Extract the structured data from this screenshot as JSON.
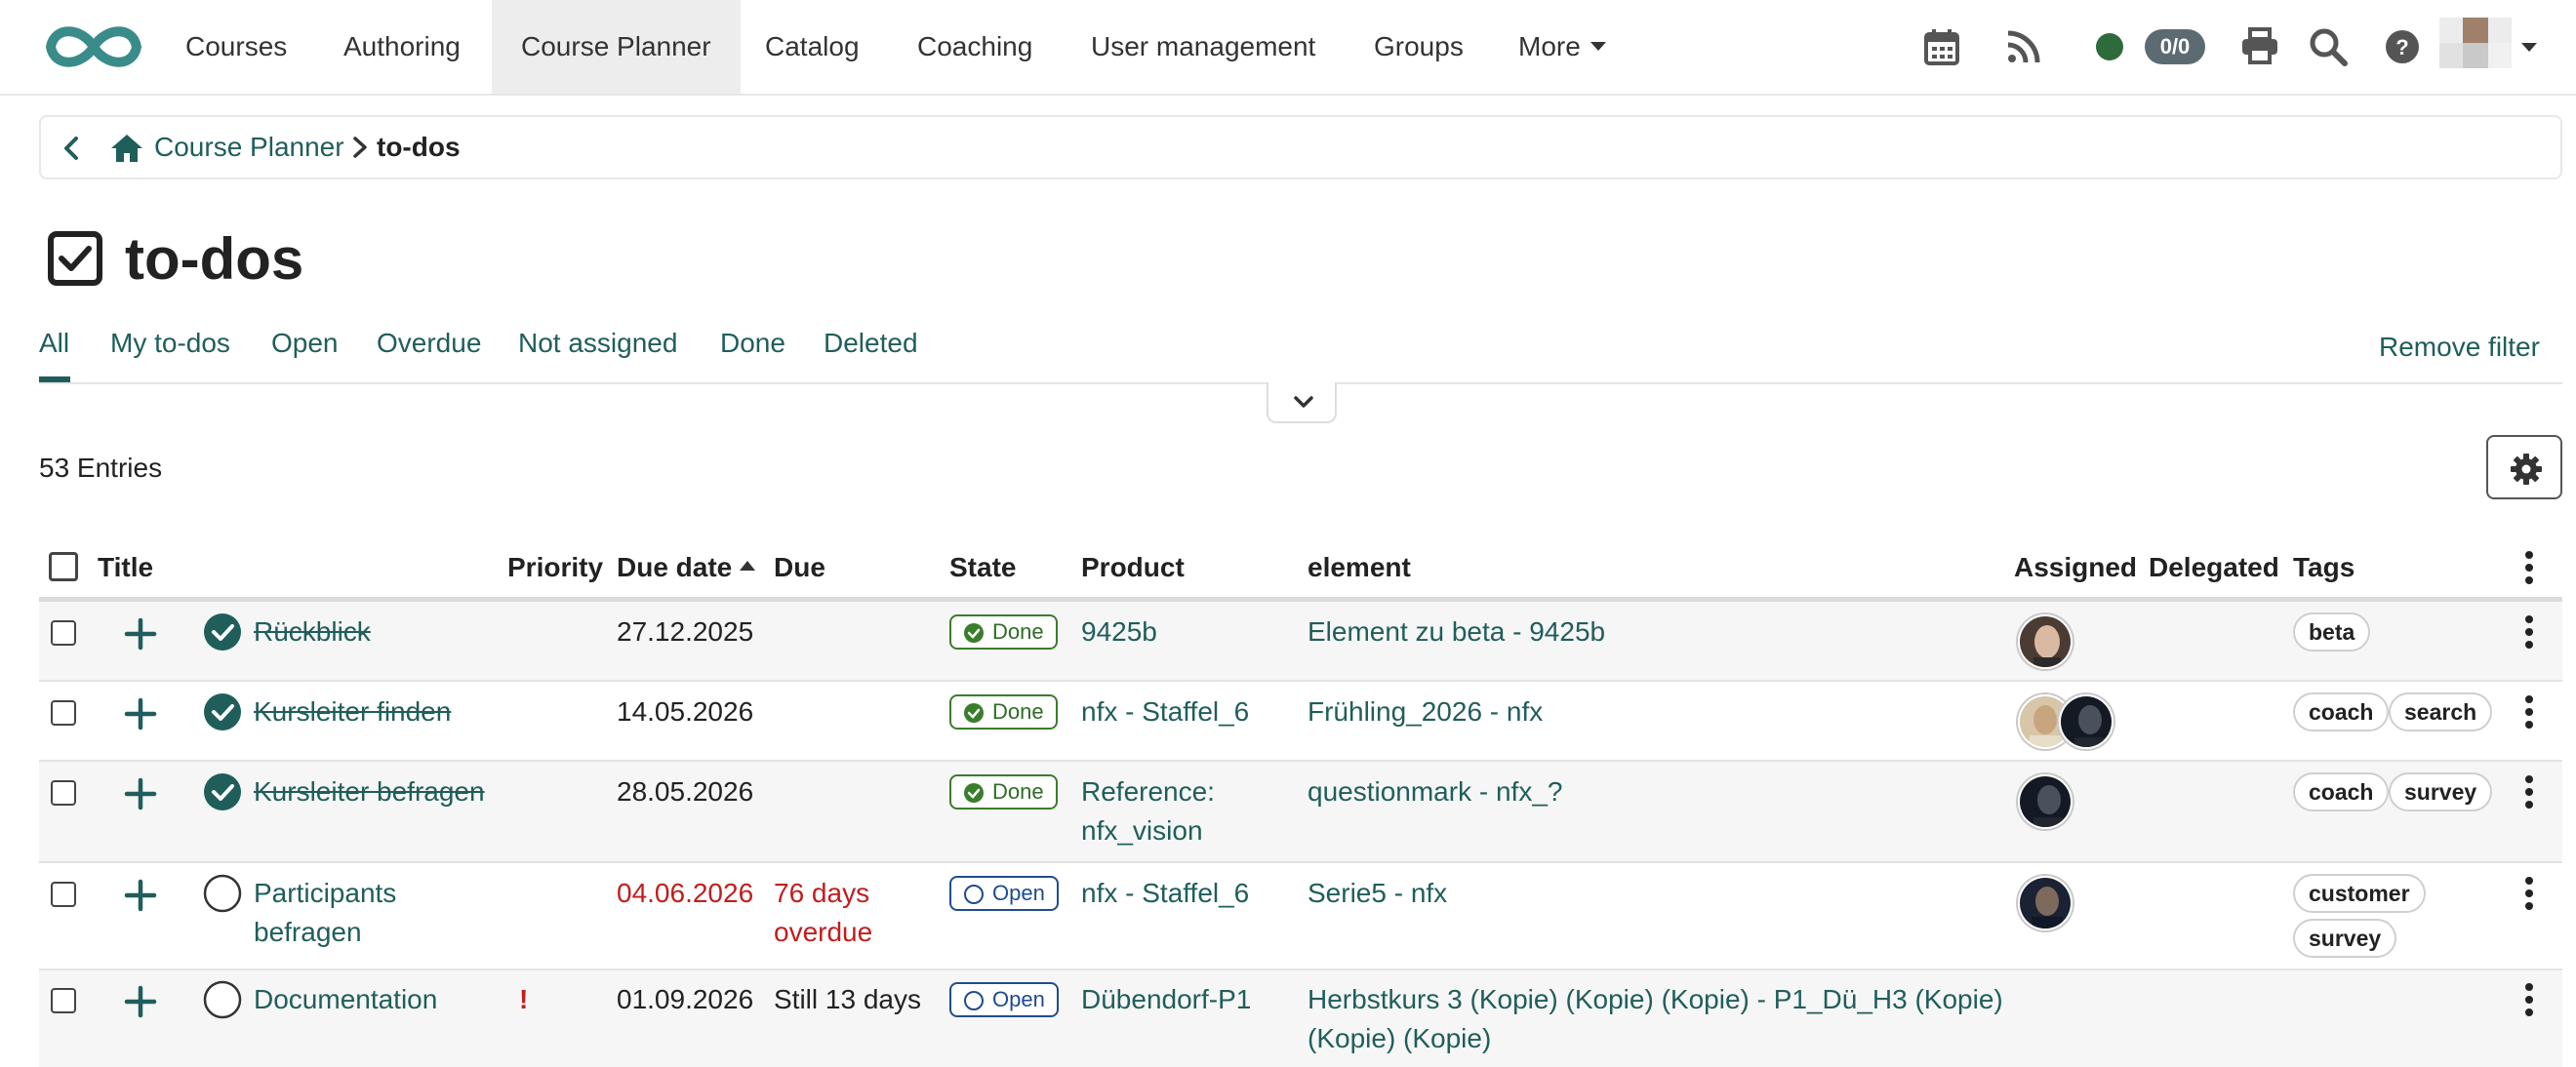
{
  "nav": {
    "items": [
      "Courses",
      "Authoring",
      "Course Planner",
      "Catalog",
      "Coaching",
      "User management",
      "Groups",
      "More"
    ],
    "active": "Course Planner",
    "badge_count": "0/0",
    "status_color": "#2e6b3a",
    "icons": [
      "calendar-icon",
      "rss-icon",
      "print-icon",
      "search-icon",
      "help-icon"
    ]
  },
  "breadcrumb": {
    "parent": "Course Planner",
    "current": "to-dos"
  },
  "page": {
    "title": "to-dos"
  },
  "tabs": [
    "All",
    "My to-dos",
    "Open",
    "Overdue",
    "Not assigned",
    "Done",
    "Deleted"
  ],
  "active_tab": "All",
  "remove_filter": "Remove filter",
  "entries": "53 Entries",
  "table": {
    "headers": {
      "title": "Title",
      "priority": "Priority",
      "due_date": "Due date",
      "due": "Due",
      "state": "State",
      "product": "Product",
      "element": "element",
      "assigned": "Assigned",
      "delegated": "Delegated",
      "tags": "Tags"
    },
    "rows": [
      {
        "title": "Rückblick",
        "priority": "",
        "due_date": "27.12.2025",
        "due": "",
        "state": "Done",
        "product": "9425b",
        "element": "Element zu beta - 9425b",
        "tags": [
          "beta"
        ]
      },
      {
        "title": "Kursleiter finden",
        "priority": "",
        "due_date": "14.05.2026",
        "due": "",
        "state": "Done",
        "product": "nfx - Staffel_6",
        "element": "Frühling_2026 - nfx",
        "tags": [
          "coach",
          "search"
        ]
      },
      {
        "title": "Kursleiter befragen",
        "priority": "",
        "due_date": "28.05.2026",
        "due": "",
        "state": "Done",
        "product_line1": "Reference:",
        "product_line2": "nfx_vision",
        "element": "questionmark - nfx_?",
        "tags": [
          "coach",
          "survey"
        ]
      },
      {
        "title_line1": "Participants",
        "title_line2": "befragen",
        "priority": "",
        "due_date": "04.06.2026",
        "due_line1": "76 days",
        "due_line2": "overdue",
        "state": "Open",
        "product": "nfx - Staffel_6",
        "element": "Serie5 - nfx",
        "tags": [
          "customer",
          "survey"
        ]
      },
      {
        "title": "Documentation",
        "priority": "!",
        "due_date": "01.09.2026",
        "due": "Still 13 days",
        "state": "Open",
        "product": "Dübendorf-P1",
        "element_line1": "Herbstkurs 3 (Kopie) (Kopie) (Kopie) - P1_Dü_H3 (Kopie)",
        "element_line2": "(Kopie) (Kopie)",
        "tags": []
      }
    ]
  },
  "colors": {
    "accent": "#1f5e5b",
    "overdue": "#c21d1d",
    "done": "#3a7d2b",
    "open": "#1f4c8f"
  }
}
